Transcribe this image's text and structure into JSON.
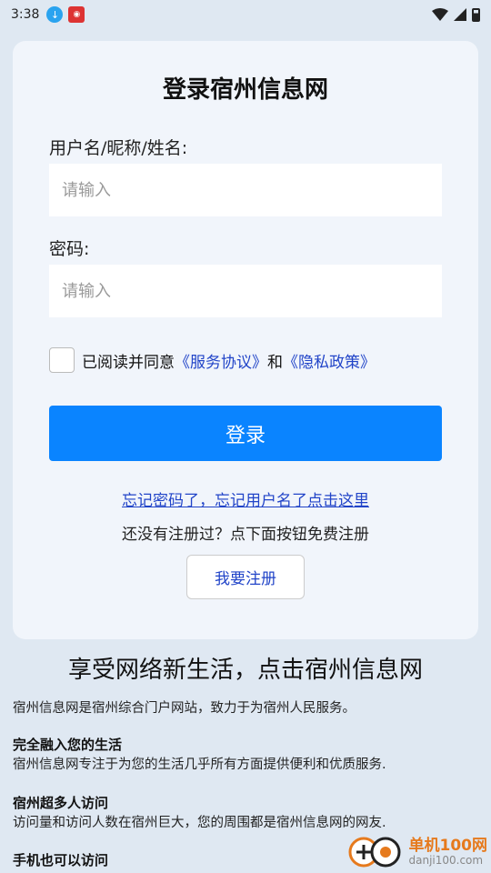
{
  "status_bar": {
    "time": "3:38"
  },
  "login": {
    "title": "登录宿州信息网",
    "username_label": "用户名/昵称/姓名:",
    "username_placeholder": "请输入",
    "password_label": "密码:",
    "password_placeholder": "请输入",
    "agree_prefix": "已阅读并同意",
    "service_link": "《服务协议》",
    "agree_and": "和",
    "privacy_link": "《隐私政策》",
    "login_button": "登录",
    "forgot_link": "忘记密码了，忘记用户名了点击这里",
    "register_hint": "还没有注册过？点下面按钮免费注册",
    "register_button": "我要注册"
  },
  "promo": {
    "slogan": "享受网络新生活，点击宿州信息网",
    "intro": "宿州信息网是宿州综合门户网站，致力于为宿州人民服务。",
    "blocks": [
      {
        "heading": "完全融入您的生活",
        "text": "宿州信息网专注于为您的生活几乎所有方面提供便利和优质服务."
      },
      {
        "heading": "宿州超多人访问",
        "text": "访问量和访问人数在宿州巨大，您的周围都是宿州信息网的网友."
      },
      {
        "heading": "手机也可以访问"
      }
    ]
  },
  "watermark": {
    "name": "单机100网",
    "url": "danji100.com"
  },
  "colors": {
    "accent": "#0a84ff",
    "link": "#2144c8",
    "background": "#dfe8f2",
    "card": "#f1f5fb"
  }
}
